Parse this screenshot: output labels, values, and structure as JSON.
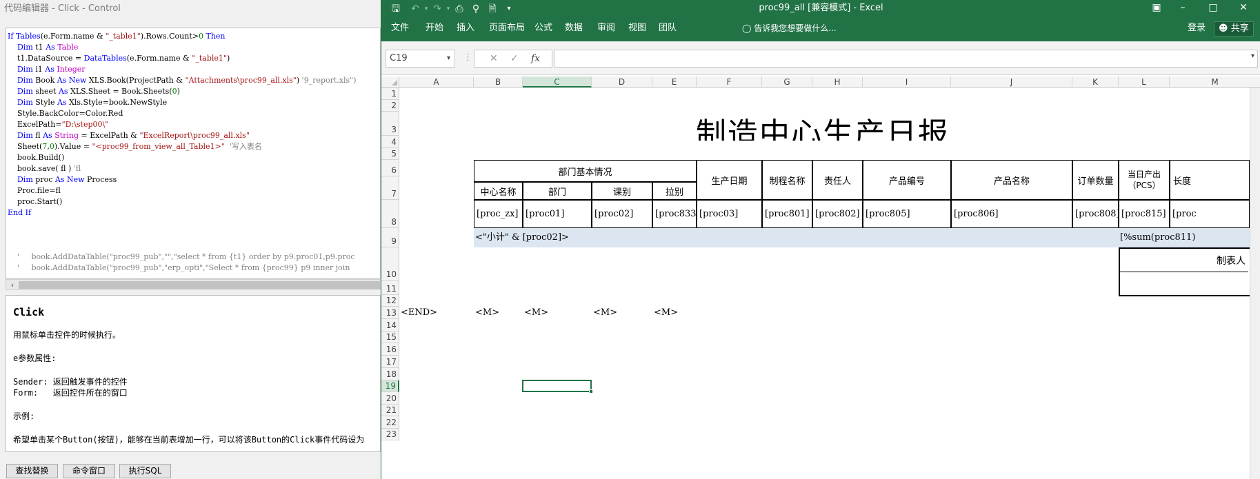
{
  "editor": {
    "title": "代码编辑器 - Click - Control",
    "code_lines": [
      [
        {
          "t": "If ",
          "c": "kw"
        },
        {
          "t": "Tables",
          "c": "kw"
        },
        {
          "t": "(e.Form.name & ",
          "c": "tx"
        },
        {
          "t": "\"_table1\"",
          "c": "st"
        },
        {
          "t": ").Rows.Count>",
          "c": "tx"
        },
        {
          "t": "0",
          "c": "nm"
        },
        {
          "t": " Then",
          "c": "kw"
        }
      ],
      [
        {
          "t": "    Dim ",
          "c": "kw"
        },
        {
          "t": "t1 ",
          "c": "tx"
        },
        {
          "t": "As ",
          "c": "kw"
        },
        {
          "t": "Table",
          "c": "ty"
        }
      ],
      [
        {
          "t": "    t1.DataSource = ",
          "c": "tx"
        },
        {
          "t": "DataTables",
          "c": "kw"
        },
        {
          "t": "(e.Form.name & ",
          "c": "tx"
        },
        {
          "t": "\"_table1\"",
          "c": "st"
        },
        {
          "t": ")",
          "c": "tx"
        }
      ],
      [
        {
          "t": "    Dim ",
          "c": "kw"
        },
        {
          "t": "i1 ",
          "c": "tx"
        },
        {
          "t": "As ",
          "c": "kw"
        },
        {
          "t": "Integer",
          "c": "ty"
        }
      ],
      [
        {
          "t": "    Dim ",
          "c": "kw"
        },
        {
          "t": "Book ",
          "c": "tx"
        },
        {
          "t": "As New ",
          "c": "kw"
        },
        {
          "t": "XLS.Book(ProjectPath & ",
          "c": "tx"
        },
        {
          "t": "\"Attachments\\proc99_all.xls\"",
          "c": "st"
        },
        {
          "t": ") ",
          "c": "tx"
        },
        {
          "t": "'9_report.xls\")",
          "c": "cm"
        }
      ],
      [
        {
          "t": "    Dim ",
          "c": "kw"
        },
        {
          "t": "sheet ",
          "c": "tx"
        },
        {
          "t": "As ",
          "c": "kw"
        },
        {
          "t": "XLS.Sheet = Book.Sheets(",
          "c": "tx"
        },
        {
          "t": "0",
          "c": "nm"
        },
        {
          "t": ")",
          "c": "tx"
        }
      ],
      [
        {
          "t": "    Dim ",
          "c": "kw"
        },
        {
          "t": "Style ",
          "c": "tx"
        },
        {
          "t": "As ",
          "c": "kw"
        },
        {
          "t": "Xls.Style=book.NewStyle",
          "c": "tx"
        }
      ],
      [
        {
          "t": "    Style.BackColor=Color.Red",
          "c": "tx"
        }
      ],
      [
        {
          "t": "    ExcelPath=",
          "c": "tx"
        },
        {
          "t": "\"D:\\step00\\\"",
          "c": "st"
        }
      ],
      [
        {
          "t": "    Dim ",
          "c": "kw"
        },
        {
          "t": "fl ",
          "c": "tx"
        },
        {
          "t": "As ",
          "c": "kw"
        },
        {
          "t": "String",
          "c": "ty"
        },
        {
          "t": " = ExcelPath & ",
          "c": "tx"
        },
        {
          "t": "\"ExcelReport\\proc99_all.xls\"",
          "c": "st"
        }
      ],
      [
        {
          "t": "    Sheet(",
          "c": "tx"
        },
        {
          "t": "7",
          "c": "nm"
        },
        {
          "t": ",",
          "c": "tx"
        },
        {
          "t": "0",
          "c": "nm"
        },
        {
          "t": ").Value = ",
          "c": "tx"
        },
        {
          "t": "\"<proc99_from_view_all_Table1>\"",
          "c": "st"
        },
        {
          "t": "  '写入表名",
          "c": "cm"
        }
      ],
      [
        {
          "t": "    book.Build()",
          "c": "tx"
        }
      ],
      [
        {
          "t": "    book.save( fl ) ",
          "c": "tx"
        },
        {
          "t": "'fl",
          "c": "cm"
        }
      ],
      [
        {
          "t": "    Dim ",
          "c": "kw"
        },
        {
          "t": "proc ",
          "c": "tx"
        },
        {
          "t": "As New ",
          "c": "kw"
        },
        {
          "t": "Process",
          "c": "tx"
        }
      ],
      [
        {
          "t": "    Proc.file=fl",
          "c": "tx"
        }
      ],
      [
        {
          "t": "    proc.Start()",
          "c": "tx"
        }
      ],
      [
        {
          "t": "End If",
          "c": "kw"
        }
      ],
      [
        {
          "t": "",
          "c": "tx"
        }
      ],
      [
        {
          "t": "",
          "c": "tx"
        }
      ],
      [
        {
          "t": "",
          "c": "tx"
        }
      ],
      [
        {
          "t": "    '     book.AddDataTable(\"proc99_pub\",\"\",\"select * from {t1} order by p9.proc01,p9.proc",
          "c": "cm"
        }
      ],
      [
        {
          "t": "    '     book.AddDataTable(\"proc99_pub\",\"erp_opti\",\"Select * from {proc99} p9 inner join",
          "c": "cm"
        }
      ]
    ],
    "help": {
      "title": "Click",
      "lines": [
        "用鼠标单击控件的时候执行。",
        "",
        "e参数属性:",
        "",
        "Sender: 返回触发事件的控件",
        "Form:   返回控件所在的窗口",
        "",
        "示例:",
        "",
        "希望单击某个Button(按钮)，能够在当前表增加一行，可以将该Button的Click事件代码设为"
      ]
    },
    "buttons": {
      "find_replace": "查找替换",
      "command_window": "命令窗口",
      "exec_sql": "执行SQL"
    }
  },
  "excel": {
    "title": "proc99_all  [兼容模式] - Excel",
    "tabs": [
      "文件",
      "开始",
      "插入",
      "页面布局",
      "公式",
      "数据",
      "审阅",
      "视图",
      "团队"
    ],
    "tell_me": "告诉我您想要做什么...",
    "login": "登录",
    "share": "共享",
    "name_box": "C19",
    "fx": "fx",
    "columns": [
      "A",
      "B",
      "C",
      "D",
      "E",
      "F",
      "G",
      "H",
      "I",
      "J",
      "K",
      "L",
      "M"
    ],
    "rows": [
      "1",
      "2",
      "3",
      "4",
      "5",
      "6",
      "7",
      "8",
      "9",
      "10",
      "11",
      "12",
      "13",
      "14",
      "15",
      "16",
      "17",
      "18",
      "19",
      "20",
      "21",
      "22",
      "23"
    ],
    "selected_col": "C",
    "selected_row": "19",
    "report_title": "制造中心生产日报",
    "header": {
      "dept_basic": "部门基本情况",
      "center_name": "中心名称",
      "dept": "部门",
      "section": "课别",
      "line": "拉别",
      "prod_date": "生产日期",
      "process_name": "制程名称",
      "owner": "责任人",
      "product_code": "产品编号",
      "product_name": "产品名称",
      "order_qty": "订单数量",
      "daily_output": "当日产出（PCS）",
      "length": "长度"
    },
    "data_row": [
      "[proc_zx]",
      "[proc01]",
      "[proc02]",
      "[proc833]",
      "[proc03]",
      "[proc801]",
      "[proc802]",
      "[proc805]",
      "[proc806]",
      "[proc808]",
      "[proc815]",
      "[proc"
    ],
    "subtotal": "<\"小计\" & [proc02]>",
    "subtotal_sum": "[%sum(proc811)",
    "maker_label": "制表人",
    "end_row": [
      "<END>",
      "<M>",
      "<M>",
      "<M>",
      "<M>"
    ]
  }
}
